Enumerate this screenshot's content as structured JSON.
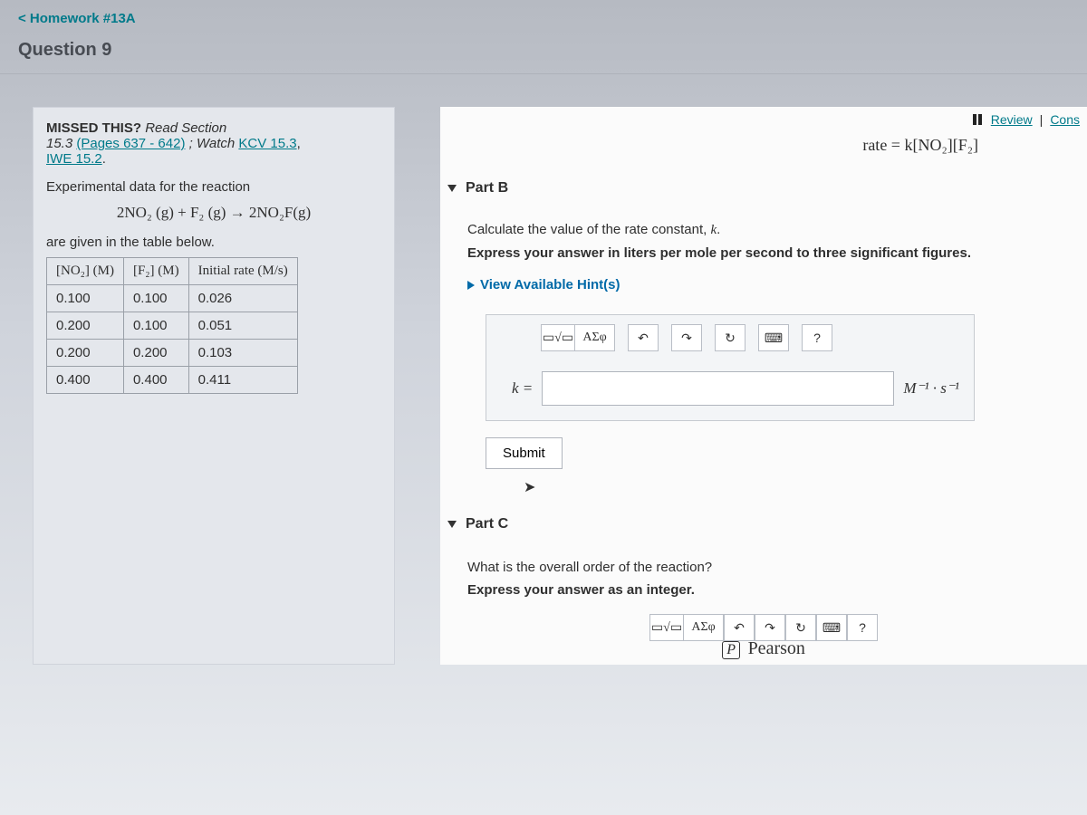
{
  "nav": {
    "back": "< Homework #13A",
    "question": "Question 9",
    "review": "Review",
    "constants": "Cons"
  },
  "rate_law": "rate = k[NO₂][F₂]",
  "left": {
    "missed_lead": "MISSED THIS?",
    "read_section": "Read Section 15.3",
    "pages": "(Pages 637 - 642)",
    "watch": "; Watch",
    "kcv": "KCV 15.3",
    "iwe": "IWE 15.2",
    "exp_intro": "Experimental data for the reaction",
    "equation": "2NO₂ (g) + F₂ (g) → 2NO₂F(g)",
    "given": "are given in the table below.",
    "headers": [
      "[NO₂] (M)",
      "[F₂] (M)",
      "Initial rate (M/s)"
    ],
    "rows": [
      [
        "0.100",
        "0.100",
        "0.026"
      ],
      [
        "0.200",
        "0.100",
        "0.051"
      ],
      [
        "0.200",
        "0.200",
        "0.103"
      ],
      [
        "0.400",
        "0.400",
        "0.411"
      ]
    ]
  },
  "partB": {
    "title": "Part B",
    "line1": "Calculate the value of the rate constant, k.",
    "line2": "Express your answer in liters per mole per second to three significant figures.",
    "hints": "View Available Hint(s)",
    "kvar": "k =",
    "units": "M⁻¹ · s⁻¹",
    "submit": "Submit",
    "tb": {
      "templates": "▭√▭",
      "greek": "ΑΣφ",
      "undo": "↶",
      "redo": "↷",
      "reset": "↻",
      "kbd": "⌨",
      "help": "?"
    }
  },
  "partC": {
    "title": "Part C",
    "q1": "What is the overall order of the reaction?",
    "q2": "Express your answer as an integer."
  },
  "footer": {
    "brand": "Pearson",
    "p": "P"
  }
}
